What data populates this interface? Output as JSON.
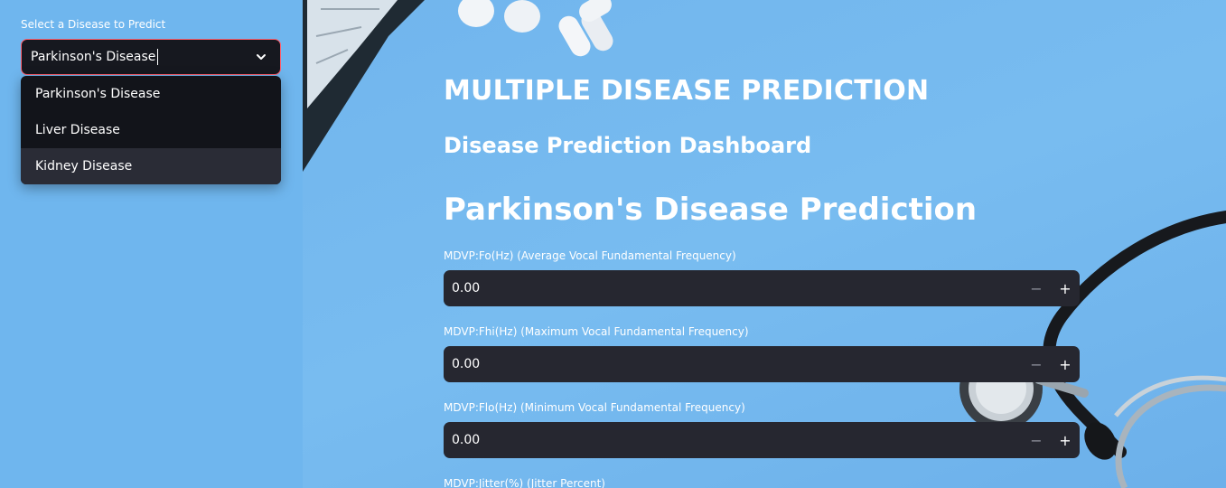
{
  "sidebar": {
    "label": "Select a Disease to Predict",
    "selected": "Parkinson's Disease",
    "options": [
      "Parkinson's Disease",
      "Liver Disease",
      "Kidney Disease"
    ]
  },
  "header": {
    "title": "MULTIPLE DISEASE PREDICTION",
    "subtitle": "Disease Prediction Dashboard"
  },
  "section": {
    "title": "Parkinson's Disease Prediction"
  },
  "fields": [
    {
      "label": "MDVP:Fo(Hz) (Average Vocal Fundamental Frequency)",
      "value": "0.00"
    },
    {
      "label": "MDVP:Fhi(Hz) (Maximum Vocal Fundamental Frequency)",
      "value": "0.00"
    },
    {
      "label": "MDVP:Flo(Hz) (Minimum Vocal Fundamental Frequency)",
      "value": "0.00"
    },
    {
      "label": "MDVP:Jitter(%) (Jitter Percent)",
      "value": ""
    }
  ],
  "stepper": {
    "minus": "−",
    "plus": "+"
  }
}
